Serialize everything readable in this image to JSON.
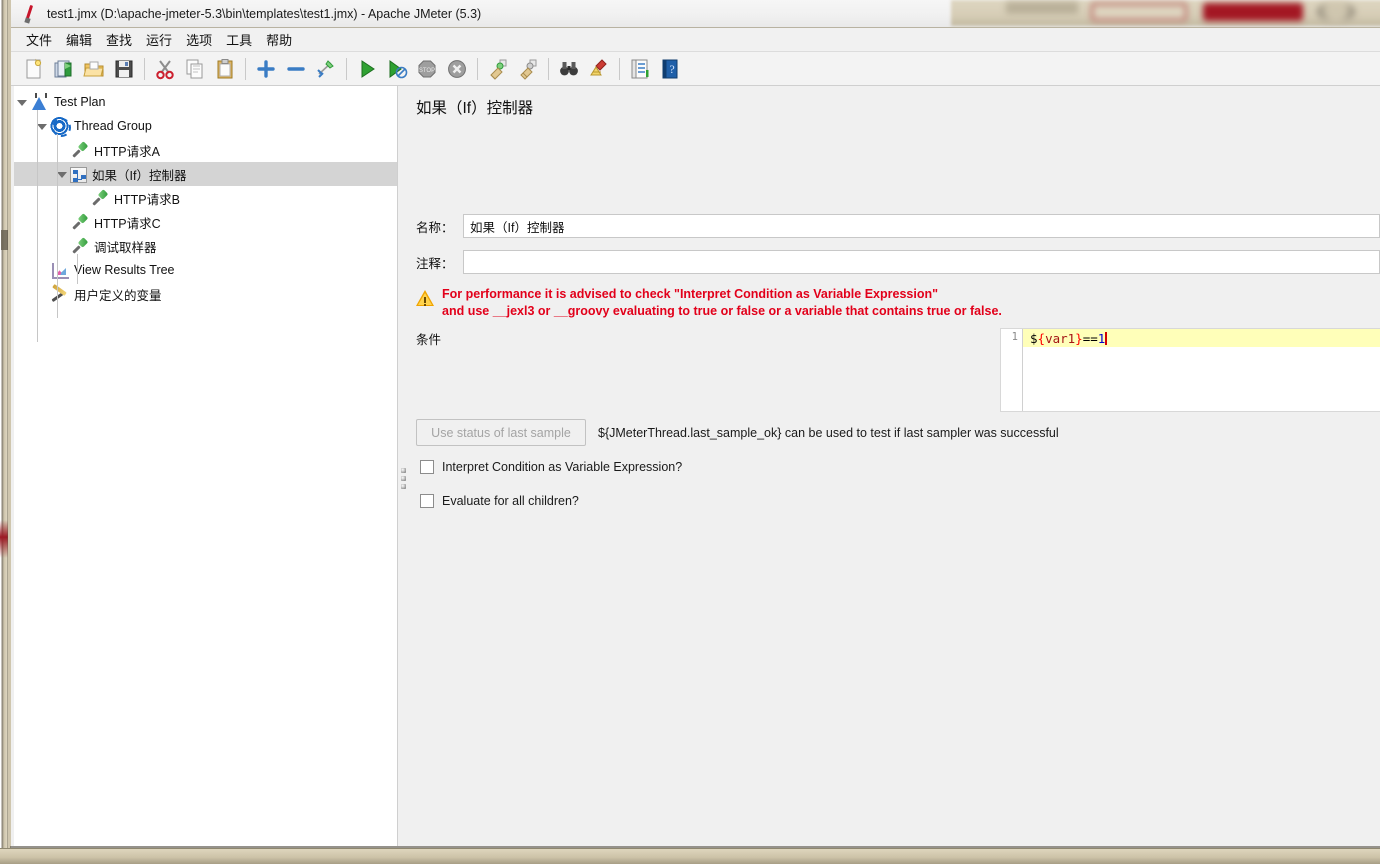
{
  "window": {
    "title": "test1.jmx (D:\\apache-jmeter-5.3\\bin\\templates\\test1.jmx) - Apache JMeter (5.3)",
    "app_icon": "jmeter-feather-icon"
  },
  "menubar": {
    "items": [
      {
        "label": "文件",
        "name": "menu-file"
      },
      {
        "label": "编辑",
        "name": "menu-edit"
      },
      {
        "label": "查找",
        "name": "menu-search"
      },
      {
        "label": "运行",
        "name": "menu-run"
      },
      {
        "label": "选项",
        "name": "menu-options"
      },
      {
        "label": "工具",
        "name": "menu-tools"
      },
      {
        "label": "帮助",
        "name": "menu-help"
      }
    ]
  },
  "toolbar": {
    "buttons": [
      {
        "icon": "new-document-icon",
        "title": "New"
      },
      {
        "icon": "templates-icon",
        "title": "Templates"
      },
      {
        "icon": "open-folder-icon",
        "title": "Open"
      },
      {
        "icon": "save-icon",
        "title": "Save"
      },
      {
        "sep": true
      },
      {
        "icon": "cut-scissors-icon",
        "title": "Cut"
      },
      {
        "icon": "copy-icon",
        "title": "Copy"
      },
      {
        "icon": "paste-clipboard-icon",
        "title": "Paste"
      },
      {
        "sep": true
      },
      {
        "icon": "expand-plus-icon",
        "title": "Expand All"
      },
      {
        "icon": "collapse-minus-icon",
        "title": "Collapse All"
      },
      {
        "icon": "toggle-pins-icon",
        "title": "Toggle"
      },
      {
        "sep": true
      },
      {
        "icon": "start-play-icon",
        "title": "Start"
      },
      {
        "icon": "start-no-timers-icon",
        "title": "Start no pauses"
      },
      {
        "icon": "stop-icon",
        "title": "Stop"
      },
      {
        "icon": "shutdown-icon",
        "title": "Shutdown"
      },
      {
        "sep": true
      },
      {
        "icon": "clear-broom-icon",
        "title": "Clear"
      },
      {
        "icon": "clear-all-broom-icon",
        "title": "Clear All"
      },
      {
        "sep": true
      },
      {
        "icon": "search-binoculars-icon",
        "title": "Search"
      },
      {
        "icon": "reset-search-broom-icon",
        "title": "Reset Search"
      },
      {
        "sep": true
      },
      {
        "icon": "function-helper-icon",
        "title": "Function Helper Dialog"
      },
      {
        "icon": "help-book-icon",
        "title": "Help"
      }
    ]
  },
  "tree": {
    "nodes": [
      {
        "label": "Test Plan",
        "icon": "test-plan-icon",
        "depth": 0,
        "toggle": "open",
        "selected": false,
        "name": "tree-node-test-plan"
      },
      {
        "label": "Thread Group",
        "icon": "thread-group-icon",
        "depth": 1,
        "toggle": "open",
        "selected": false,
        "name": "tree-node-thread-group"
      },
      {
        "label": "HTTP请求A",
        "icon": "http-sampler-icon",
        "depth": 2,
        "toggle": "none",
        "selected": false,
        "name": "tree-node-http-request-a"
      },
      {
        "label": "如果（If）控制器",
        "icon": "if-controller-icon",
        "depth": 2,
        "toggle": "open",
        "selected": true,
        "name": "tree-node-if-controller"
      },
      {
        "label": "HTTP请求B",
        "icon": "http-sampler-icon",
        "depth": 3,
        "toggle": "none",
        "selected": false,
        "name": "tree-node-http-request-b"
      },
      {
        "label": "HTTP请求C",
        "icon": "http-sampler-icon",
        "depth": 2,
        "toggle": "none",
        "selected": false,
        "name": "tree-node-http-request-c"
      },
      {
        "label": "调试取样器",
        "icon": "debug-sampler-icon",
        "depth": 2,
        "toggle": "none",
        "selected": false,
        "name": "tree-node-debug-sampler"
      },
      {
        "label": "View Results Tree",
        "icon": "view-results-tree-icon",
        "depth": 1,
        "toggle": "none",
        "selected": false,
        "name": "tree-node-view-results-tree"
      },
      {
        "label": "用户定义的变量",
        "icon": "user-defined-variables-icon",
        "depth": 1,
        "toggle": "none",
        "selected": false,
        "name": "tree-node-user-defined-variables"
      }
    ]
  },
  "panel": {
    "title": "如果（If）控制器",
    "name_label": "名称：",
    "name_value": "如果（If）控制器",
    "comment_label": "注释：",
    "comment_value": "",
    "warning": {
      "icon": "warning-triangle-icon",
      "line1": "For performance it is advised to check \"Interpret Condition as Variable Expression\"",
      "line2": "and use __jexl3 or __groovy evaluating to true or false or a variable that contains true or false."
    },
    "condition": {
      "label": "条件",
      "line_number": "1",
      "tokens": {
        "dollar": "$",
        "brace_open": "{",
        "var": "var1",
        "brace_close": "}",
        "operator": "==",
        "number": "1"
      },
      "value": "${var1}==1"
    },
    "last_sample_button": "Use status of last sample",
    "last_sample_hint": "${JMeterThread.last_sample_ok} can be used to test if last sampler was successful",
    "checkboxes": [
      {
        "label": "Interpret Condition as Variable Expression?",
        "checked": false,
        "name": "checkbox-interpret-condition"
      },
      {
        "label": "Evaluate for all children?",
        "checked": false,
        "name": "checkbox-evaluate-all-children"
      }
    ]
  },
  "colors": {
    "warning_text": "#e2001a",
    "selection": "#d4d4d4",
    "editor_current_line": "#ffffb9",
    "variable_token": "#a31515",
    "number_token": "#0000cd",
    "caret": "#d40000"
  }
}
